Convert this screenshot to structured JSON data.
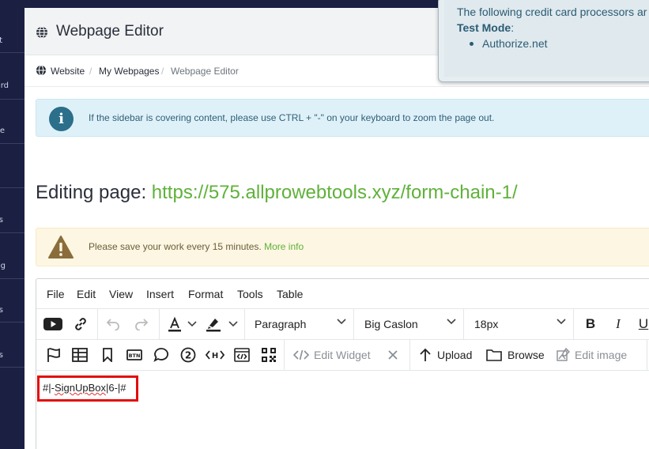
{
  "sidebar": {
    "items": [
      "t",
      "rd",
      "e",
      "s",
      "g",
      "s",
      "s"
    ]
  },
  "header": {
    "title": "Webpage Editor"
  },
  "breadcrumb": {
    "items": [
      "Website",
      "My Webpages",
      "Webpage Editor"
    ]
  },
  "info_alert": {
    "icon": "info-icon",
    "text": "If the sidebar is covering content, please use CTRL + \"-\" on your keyboard to zoom the page out."
  },
  "editing": {
    "prefix": "Editing page:",
    "url": "https://575.allprowebtools.xyz/form-chain-1/"
  },
  "warn_alert": {
    "icon": "warning-icon",
    "text": "Please save your work every 15 minutes.",
    "link": "More info"
  },
  "editor": {
    "menus": [
      "File",
      "Edit",
      "View",
      "Insert",
      "Format",
      "Tools",
      "Table"
    ],
    "block_format": "Paragraph",
    "font_family": "Big Caslon",
    "font_size": "18px",
    "edit_widget": "Edit Widget",
    "upload": "Upload",
    "browse": "Browse",
    "edit_image": "Edit image",
    "content_prefix": "#|-",
    "content_word": "SignUpBox",
    "content_suffix": "|6-|#"
  },
  "popup": {
    "line1": "The following credit card processors ar",
    "mode_label": "Test Mode",
    "mode_colon": ":",
    "processor": "Authorize.net"
  },
  "colors": {
    "sidebar_bg": "#1b2042",
    "url_green": "#5fb13a",
    "info_bg": "#dff1f8",
    "warn_bg": "#fdf6e2",
    "highlight_red": "#e30d0d"
  }
}
